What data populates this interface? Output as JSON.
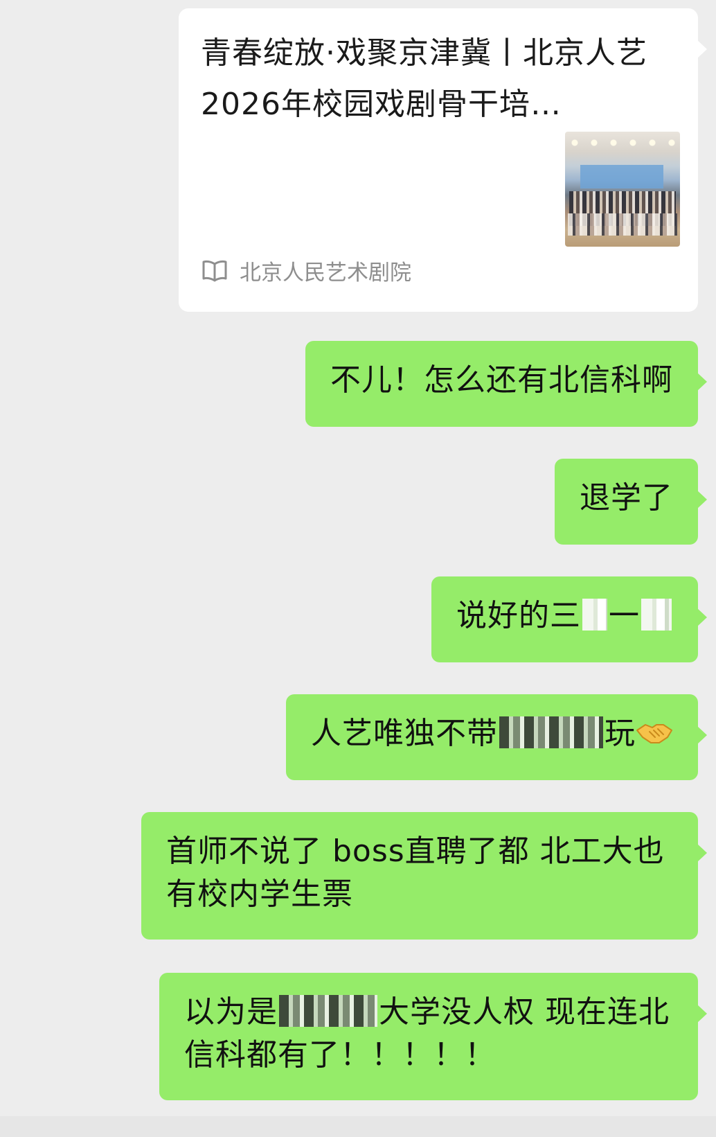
{
  "article_card": {
    "title": "青春绽放·戏聚京津冀丨北京人艺2026年校园戏剧骨干培…",
    "source_icon": "book-open-icon",
    "source": "北京人民艺术剧院"
  },
  "messages": [
    {
      "parts": [
        "不儿！怎么还有北信科啊"
      ]
    },
    {
      "parts": [
        "退学了"
      ]
    },
    {
      "parts": [
        "说好的三",
        "一"
      ],
      "redacted": true
    },
    {
      "parts": [
        "人艺唯独不带",
        "玩"
      ],
      "redacted": true,
      "emoji": "handshake-emoji"
    },
    {
      "text": "首师不说了 boss直聘了都 北工大也有校内学生票"
    },
    {
      "parts": [
        "以为是",
        "大学没人权 现在连北信科都有了！！！！！"
      ],
      "redacted": true
    }
  ],
  "colors": {
    "background": "#ededed",
    "outgoing_bubble": "#95ec69",
    "card_background": "#ffffff",
    "source_text": "#8e8e8e"
  }
}
